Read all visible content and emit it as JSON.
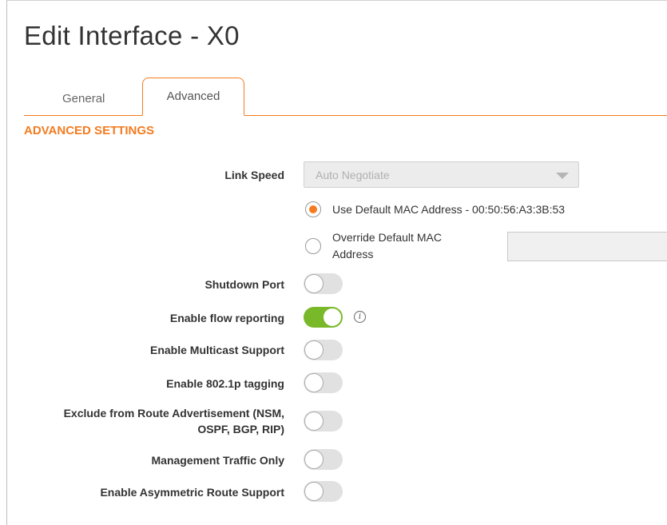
{
  "title": "Edit Interface - X0",
  "tabs": [
    {
      "label": "General",
      "active": false
    },
    {
      "label": "Advanced",
      "active": true
    }
  ],
  "section_title": "ADVANCED SETTINGS",
  "link_speed": {
    "label": "Link Speed",
    "value": "Auto Negotiate"
  },
  "mac": {
    "default_option": "Use Default MAC Address - 00:50:56:A3:3B:53",
    "override_option_line1": "Override Default MAC",
    "override_option_line2": "Address",
    "selected": "default",
    "override_value": ""
  },
  "toggles": [
    {
      "label": "Shutdown Port",
      "on": false
    },
    {
      "label": "Enable flow reporting",
      "on": true
    },
    {
      "label": "Enable Multicast Support",
      "on": false
    },
    {
      "label": "Enable 802.1p tagging",
      "on": false
    },
    {
      "label_line1": "Exclude from Route Advertisement (NSM,",
      "label_line2": "OSPF, BGP, RIP)",
      "on": false
    },
    {
      "label": "Management Traffic Only",
      "on": false
    },
    {
      "label": "Enable Asymmetric Route Support",
      "on": false
    }
  ],
  "icons": {
    "info": "info-icon",
    "dropdown": "chevron-down-icon"
  },
  "colors": {
    "accent": "#f47b20",
    "toggle_on": "#79b829",
    "toggle_off": "#e1e1e1"
  }
}
